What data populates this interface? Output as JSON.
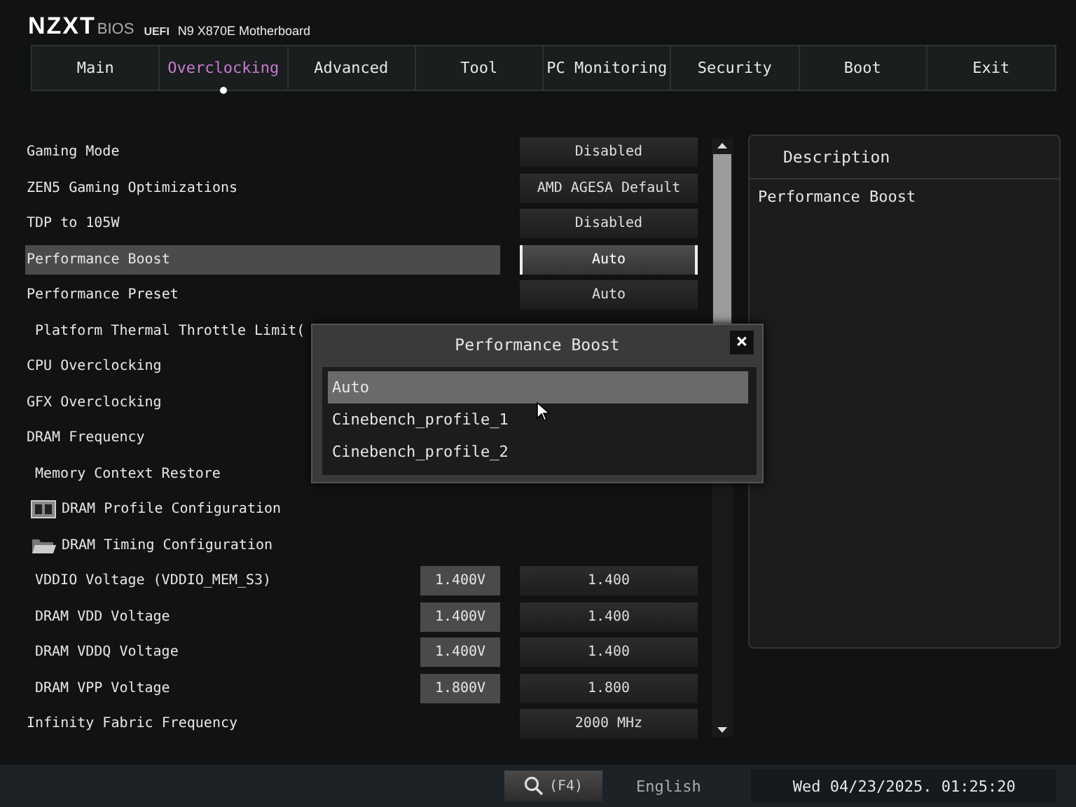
{
  "header": {
    "brand": "NZXT",
    "bios": "BIOS",
    "uefi": "UEFI",
    "board": "N9 X870E Motherboard"
  },
  "tabs": [
    {
      "label": "Main",
      "selected": false
    },
    {
      "label": "Overclocking",
      "selected": true
    },
    {
      "label": "Advanced",
      "selected": false
    },
    {
      "label": "Tool",
      "selected": false
    },
    {
      "label": "PC Monitoring",
      "selected": false
    },
    {
      "label": "Security",
      "selected": false
    },
    {
      "label": "Boot",
      "selected": false
    },
    {
      "label": "Exit",
      "selected": false
    }
  ],
  "settings": [
    {
      "kind": "option",
      "label": "Gaming Mode",
      "value": "Disabled",
      "indent": false,
      "selected": false
    },
    {
      "kind": "option",
      "label": "ZEN5 Gaming Optimizations",
      "value": "AMD AGESA Default",
      "indent": false,
      "selected": false
    },
    {
      "kind": "option",
      "label": "TDP to 105W",
      "value": "Disabled",
      "indent": false,
      "selected": false
    },
    {
      "kind": "option",
      "label": "Performance Boost",
      "value": "Auto",
      "indent": false,
      "selected": true
    },
    {
      "kind": "option",
      "label": "Performance Preset",
      "value": "Auto",
      "indent": false,
      "selected": false
    },
    {
      "kind": "option",
      "label": "Platform Thermal Throttle Limit(",
      "indent": true,
      "selected": false
    },
    {
      "kind": "option",
      "label": "CPU Overclocking",
      "indent": false,
      "selected": false
    },
    {
      "kind": "option",
      "label": "GFX Overclocking",
      "indent": false,
      "selected": false
    },
    {
      "kind": "option",
      "label": "DRAM Frequency",
      "indent": false,
      "selected": false
    },
    {
      "kind": "option",
      "label": "Memory Context Restore",
      "indent": true,
      "selected": false
    },
    {
      "kind": "memory",
      "label": "DRAM Profile Configuration"
    },
    {
      "kind": "folder",
      "label": "DRAM Timing Configuration"
    },
    {
      "kind": "voltage",
      "label": "VDDIO Voltage (VDDIO_MEM_S3)",
      "reading": "1.400V",
      "value": "1.400",
      "indent": true,
      "selected": false
    },
    {
      "kind": "voltage",
      "label": "DRAM VDD Voltage",
      "reading": "1.400V",
      "value": "1.400",
      "indent": true,
      "selected": false
    },
    {
      "kind": "voltage",
      "label": "DRAM VDDQ Voltage",
      "reading": "1.400V",
      "value": "1.400",
      "indent": true,
      "selected": false
    },
    {
      "kind": "voltage",
      "label": "DRAM VPP Voltage",
      "reading": "1.800V",
      "value": "1.800",
      "indent": true,
      "selected": false
    },
    {
      "kind": "option",
      "label": "Infinity Fabric Frequency",
      "value": "2000 MHz",
      "indent": false,
      "selected": false
    }
  ],
  "description": {
    "title": "Description",
    "text": "Performance Boost"
  },
  "popup": {
    "title": "Performance Boost",
    "close": "×",
    "options": [
      {
        "label": "Auto",
        "selected": true
      },
      {
        "label": "Cinebench_profile_1",
        "selected": false
      },
      {
        "label": "Cinebench_profile_2",
        "selected": false
      }
    ]
  },
  "status_bar": {
    "search_key": "(F4)",
    "language": "English",
    "datetime": "Wed 04/23/2025. 01:25:20"
  }
}
